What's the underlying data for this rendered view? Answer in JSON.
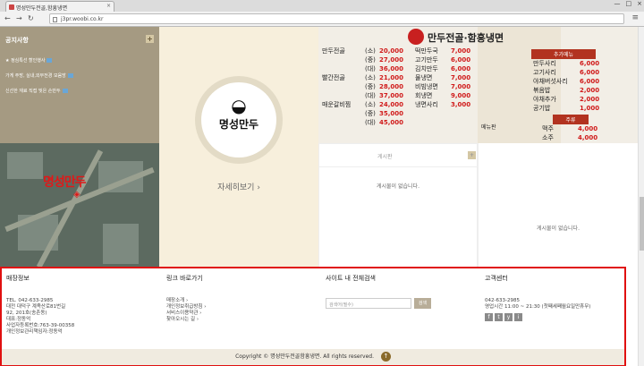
{
  "browser": {
    "tab_title": "명성만두전골,함흥냉면",
    "url": "j3pr.woobi.co.kr"
  },
  "notice": {
    "title": "공지사항",
    "items": [
      "★ 정심특선 할인행사",
      "가게 주방, 실내,외부전경 모음방",
      "신선한 재료 직접 빚은 손만두"
    ]
  },
  "map": {
    "label": "명성만두"
  },
  "brand": {
    "logo_text": "명성만두",
    "more_label": "자세히보기 ›"
  },
  "menuboard": {
    "title": "만두전골·함흥냉면",
    "col1": [
      {
        "name": "만두전골",
        "size": "(소)",
        "price": "20,000"
      },
      {
        "name": "",
        "size": "(중)",
        "price": "27,000"
      },
      {
        "name": "",
        "size": "(대)",
        "price": "36,000"
      },
      {
        "name": "빨간전골",
        "size": "(소)",
        "price": "21,000"
      },
      {
        "name": "",
        "size": "(중)",
        "price": "28,000"
      },
      {
        "name": "",
        "size": "(대)",
        "price": "37,000"
      },
      {
        "name": "매운갈비찜",
        "size": "(소)",
        "price": "24,000"
      },
      {
        "name": "",
        "size": "(중)",
        "price": "35,000"
      },
      {
        "name": "",
        "size": "(대)",
        "price": "45,000"
      }
    ],
    "col2": [
      {
        "name": "떡만두국",
        "price": "7,000"
      },
      {
        "name": "고기만두",
        "price": "6,000"
      },
      {
        "name": "김치만두",
        "price": "6,000"
      },
      {
        "name": "물냉면",
        "price": "7,000"
      },
      {
        "name": "비빔냉면",
        "price": "7,000"
      },
      {
        "name": "회냉면",
        "price": "9,000"
      },
      {
        "name": "냉면사리",
        "price": "3,000"
      }
    ],
    "col2_note": "메뉴판",
    "extra_label": "추가메뉴",
    "col3": [
      {
        "name": "만두사리",
        "price": "6,000"
      },
      {
        "name": "고기사리",
        "price": "6,000"
      },
      {
        "name": "야채버섯사리",
        "price": "6,000"
      },
      {
        "name": "볶음밥",
        "price": "2,000"
      },
      {
        "name": "야채추가",
        "price": "2,000"
      },
      {
        "name": "공기밥",
        "price": "1,000"
      }
    ],
    "drink_label": "주류",
    "col4": [
      {
        "name": "맥주",
        "price": "4,000"
      },
      {
        "name": "소주",
        "price": "4,000"
      }
    ]
  },
  "board1": {
    "title": "게시판",
    "empty_text": "게시물이 없습니다."
  },
  "board2": {
    "empty_text": "게시물이 없습니다."
  },
  "footer": {
    "store": {
      "heading": "매장정보",
      "lines": [
        "TEL. 042-633-2985",
        "대전 대덕구 계족산로81번길",
        "92, 201호(송촌동)",
        "대표:정동억",
        "사업자등록번호:763-39-00358",
        "개인정보관리책임자:정동억"
      ]
    },
    "links": {
      "heading": "링크 바로가기",
      "items": [
        "매장소개 ›",
        "개인정보취급방침 ›",
        "서비스이용약관 ›",
        "찾아오시는 길 ›"
      ]
    },
    "search": {
      "heading": "사이트 내 전체검색",
      "placeholder": "검색어(필수)",
      "button": "검색"
    },
    "cs": {
      "heading": "고객센터",
      "phone": "042-633-2985",
      "hours": "영업시간 11:00 ~ 21:30 (첫째세째월요일만휴무)",
      "social": [
        "f",
        "t",
        "y",
        "i"
      ]
    },
    "copyright": "Copyright © 명성만두전골함흥냉면. All rights reserved.",
    "top_label": "↑"
  }
}
